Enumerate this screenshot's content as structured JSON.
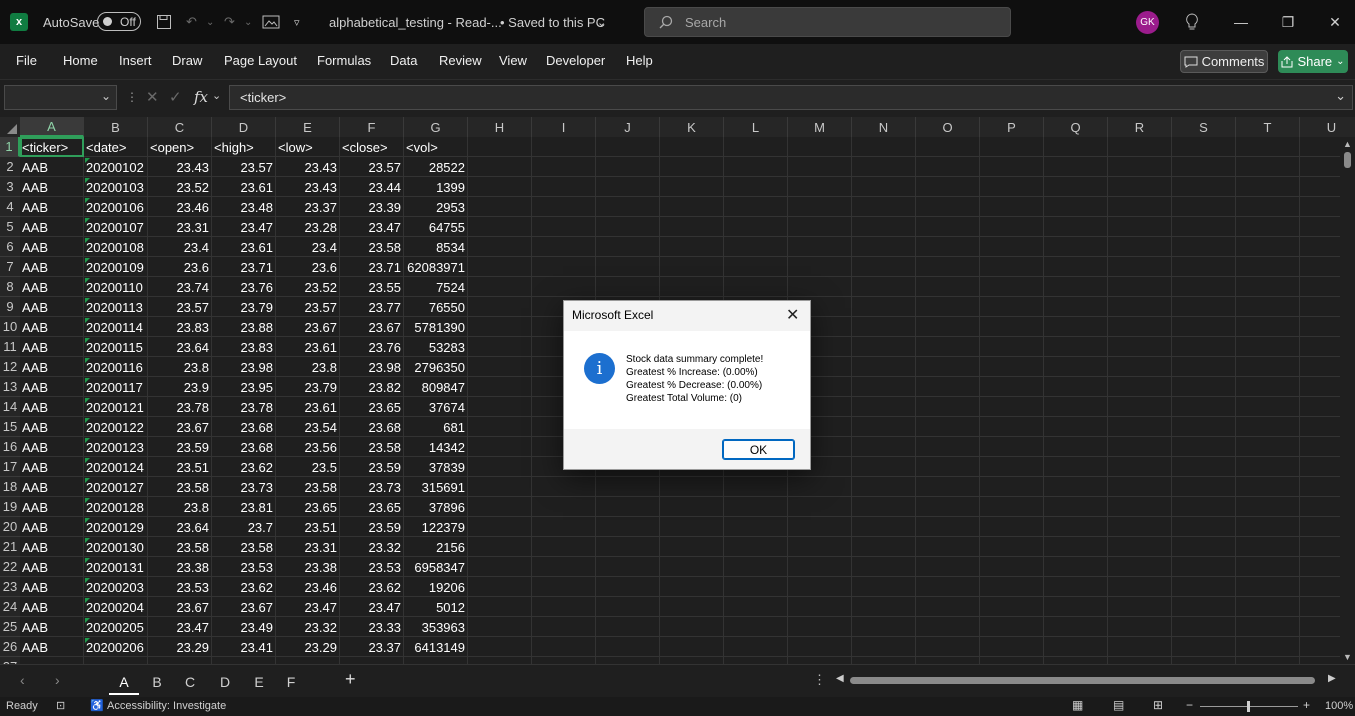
{
  "titlebar": {
    "autosave_label": "AutoSave",
    "autosave_state": "Off",
    "filename": "alphabetical_testing  -  Read-...",
    "saved_status": "•  Saved to this PC",
    "search_placeholder": "Search",
    "avatar_initials": "GK"
  },
  "ribbon": {
    "tabs": [
      "File",
      "Home",
      "Insert",
      "Draw",
      "Page Layout",
      "Formulas",
      "Data",
      "Review",
      "View",
      "Developer",
      "Help"
    ],
    "comments_label": "Comments",
    "share_label": "Share"
  },
  "formula_bar": {
    "name_box": "",
    "fx_label": "fx",
    "content": "<ticker>"
  },
  "grid": {
    "columns": [
      "A",
      "B",
      "C",
      "D",
      "E",
      "F",
      "G",
      "H",
      "I",
      "J",
      "K",
      "L",
      "M",
      "N",
      "O",
      "P",
      "Q",
      "R",
      "S",
      "T",
      "U"
    ],
    "rows": [
      [
        "<ticker>",
        "<date>",
        "<open>",
        "<high>",
        "<low>",
        "<close>",
        "<vol>"
      ],
      [
        "AAB",
        "20200102",
        "23.43",
        "23.57",
        "23.43",
        "23.57",
        "28522"
      ],
      [
        "AAB",
        "20200103",
        "23.52",
        "23.61",
        "23.43",
        "23.44",
        "1399"
      ],
      [
        "AAB",
        "20200106",
        "23.46",
        "23.48",
        "23.37",
        "23.39",
        "2953"
      ],
      [
        "AAB",
        "20200107",
        "23.31",
        "23.47",
        "23.28",
        "23.47",
        "64755"
      ],
      [
        "AAB",
        "20200108",
        "23.4",
        "23.61",
        "23.4",
        "23.58",
        "8534"
      ],
      [
        "AAB",
        "20200109",
        "23.6",
        "23.71",
        "23.6",
        "23.71",
        "62083971"
      ],
      [
        "AAB",
        "20200110",
        "23.74",
        "23.76",
        "23.52",
        "23.55",
        "7524"
      ],
      [
        "AAB",
        "20200113",
        "23.57",
        "23.79",
        "23.57",
        "23.77",
        "76550"
      ],
      [
        "AAB",
        "20200114",
        "23.83",
        "23.88",
        "23.67",
        "23.67",
        "5781390"
      ],
      [
        "AAB",
        "20200115",
        "23.64",
        "23.83",
        "23.61",
        "23.76",
        "53283"
      ],
      [
        "AAB",
        "20200116",
        "23.8",
        "23.98",
        "23.8",
        "23.98",
        "2796350"
      ],
      [
        "AAB",
        "20200117",
        "23.9",
        "23.95",
        "23.79",
        "23.82",
        "809847"
      ],
      [
        "AAB",
        "20200121",
        "23.78",
        "23.78",
        "23.61",
        "23.65",
        "37674"
      ],
      [
        "AAB",
        "20200122",
        "23.67",
        "23.68",
        "23.54",
        "23.68",
        "681"
      ],
      [
        "AAB",
        "20200123",
        "23.59",
        "23.68",
        "23.56",
        "23.58",
        "14342"
      ],
      [
        "AAB",
        "20200124",
        "23.51",
        "23.62",
        "23.5",
        "23.59",
        "37839"
      ],
      [
        "AAB",
        "20200127",
        "23.58",
        "23.73",
        "23.58",
        "23.73",
        "315691"
      ],
      [
        "AAB",
        "20200128",
        "23.8",
        "23.81",
        "23.65",
        "23.65",
        "37896"
      ],
      [
        "AAB",
        "20200129",
        "23.64",
        "23.7",
        "23.51",
        "23.59",
        "122379"
      ],
      [
        "AAB",
        "20200130",
        "23.58",
        "23.58",
        "23.31",
        "23.32",
        "2156"
      ],
      [
        "AAB",
        "20200131",
        "23.38",
        "23.53",
        "23.38",
        "23.53",
        "6958347"
      ],
      [
        "AAB",
        "20200203",
        "23.53",
        "23.62",
        "23.46",
        "23.62",
        "19206"
      ],
      [
        "AAB",
        "20200204",
        "23.67",
        "23.67",
        "23.47",
        "23.47",
        "5012"
      ],
      [
        "AAB",
        "20200205",
        "23.47",
        "23.49",
        "23.32",
        "23.33",
        "353963"
      ],
      [
        "AAB",
        "20200206",
        "23.29",
        "23.41",
        "23.29",
        "23.37",
        "6413149"
      ]
    ]
  },
  "sheet_tabs": [
    "A",
    "B",
    "C",
    "D",
    "E",
    "F"
  ],
  "active_sheet": "A",
  "statusbar": {
    "ready": "Ready",
    "accessibility": "Accessibility: Investigate",
    "zoom": "100%"
  },
  "dialog": {
    "title": "Microsoft Excel",
    "lines": [
      "Stock data summary complete!",
      "Greatest % Increase:  (0.00%)",
      "Greatest % Decrease:  (0.00%)",
      "Greatest Total Volume:  (0)"
    ],
    "ok_label": "OK"
  },
  "colors": {
    "accent_green": "#107c41",
    "share_green": "#2e8b57",
    "avatar": "#9b1c8c",
    "info_blue": "#1c6fcf"
  }
}
